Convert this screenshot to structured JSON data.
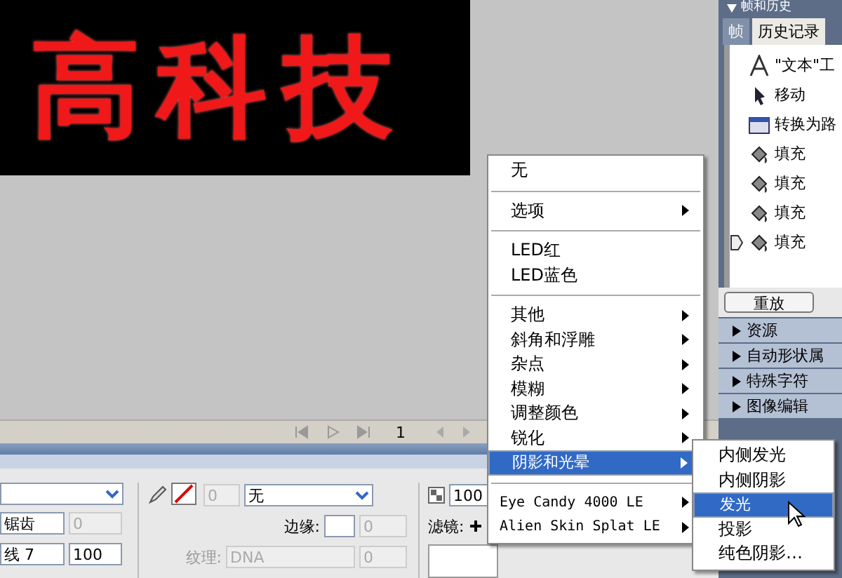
{
  "canvas": {
    "text": "高科技"
  },
  "playback": {
    "frame": "1"
  },
  "properties": {
    "antialias": {
      "value": "锯齿",
      "disabled": false
    },
    "antialias_amount": {
      "value": "0",
      "disabled": true
    },
    "line": {
      "value": "线 7"
    },
    "line_amount": {
      "value": "100",
      "disabled": false
    },
    "stroke_size": {
      "value": "0",
      "disabled": true
    },
    "stroke_type": {
      "value": "无"
    },
    "edge_label": "边缘:",
    "edge_amount": {
      "value": "0",
      "disabled": true
    },
    "texture_label": "纹理:",
    "texture": {
      "value": "DNA",
      "disabled": true
    },
    "texture_amount": {
      "value": "0",
      "disabled": true
    },
    "opacity": {
      "value": "100"
    },
    "filters_label": "滤镜:"
  },
  "menu": {
    "items": [
      {
        "kind": "item",
        "label": "无",
        "submenu": false,
        "selected": false
      },
      {
        "kind": "separator"
      },
      {
        "kind": "item",
        "label": "选项",
        "submenu": true,
        "selected": false
      },
      {
        "kind": "separator"
      },
      {
        "kind": "item",
        "label": "LED红",
        "submenu": false,
        "selected": false
      },
      {
        "kind": "item",
        "label": "LED蓝色",
        "submenu": false,
        "selected": false
      },
      {
        "kind": "separator"
      },
      {
        "kind": "item",
        "label": "其他",
        "submenu": true,
        "selected": false
      },
      {
        "kind": "item",
        "label": "斜角和浮雕",
        "submenu": true,
        "selected": false
      },
      {
        "kind": "item",
        "label": "杂点",
        "submenu": true,
        "selected": false
      },
      {
        "kind": "item",
        "label": "模糊",
        "submenu": true,
        "selected": false
      },
      {
        "kind": "item",
        "label": "调整颜色",
        "submenu": true,
        "selected": false
      },
      {
        "kind": "item",
        "label": "锐化",
        "submenu": true,
        "selected": false
      },
      {
        "kind": "item",
        "label": "阴影和光晕",
        "submenu": true,
        "selected": true
      },
      {
        "kind": "separator"
      },
      {
        "kind": "plugin",
        "label": "Eye Candy 4000 LE",
        "submenu": true,
        "selected": false
      },
      {
        "kind": "plugin",
        "label": "Alien Skin Splat LE",
        "submenu": true,
        "selected": false
      }
    ]
  },
  "submenu": {
    "items": [
      {
        "label": "内侧发光",
        "selected": false
      },
      {
        "label": "内侧阴影",
        "selected": false
      },
      {
        "label": "发光",
        "selected": true
      },
      {
        "label": "投影",
        "selected": false
      },
      {
        "label": "纯色阴影…",
        "selected": false
      }
    ]
  },
  "side_panel": {
    "title": "帧和历史",
    "tabs": [
      {
        "label": "帧",
        "selected": false
      },
      {
        "label": "历史记录",
        "selected": true
      }
    ],
    "history": [
      {
        "kind": "text",
        "label": "\"文本\"工",
        "current": false
      },
      {
        "kind": "move",
        "label": "移动",
        "current": false
      },
      {
        "kind": "convert",
        "label": "转换为路",
        "current": false
      },
      {
        "kind": "fill",
        "label": "填充",
        "current": false
      },
      {
        "kind": "fill",
        "label": "填充",
        "current": false
      },
      {
        "kind": "fill",
        "label": "填充",
        "current": false
      },
      {
        "kind": "fill",
        "label": "填充",
        "current": true
      }
    ],
    "replay_button": "重放",
    "panels": [
      {
        "label": "资源"
      },
      {
        "label": "自动形状属"
      },
      {
        "label": "特殊字符"
      },
      {
        "label": "图像编辑"
      }
    ]
  }
}
